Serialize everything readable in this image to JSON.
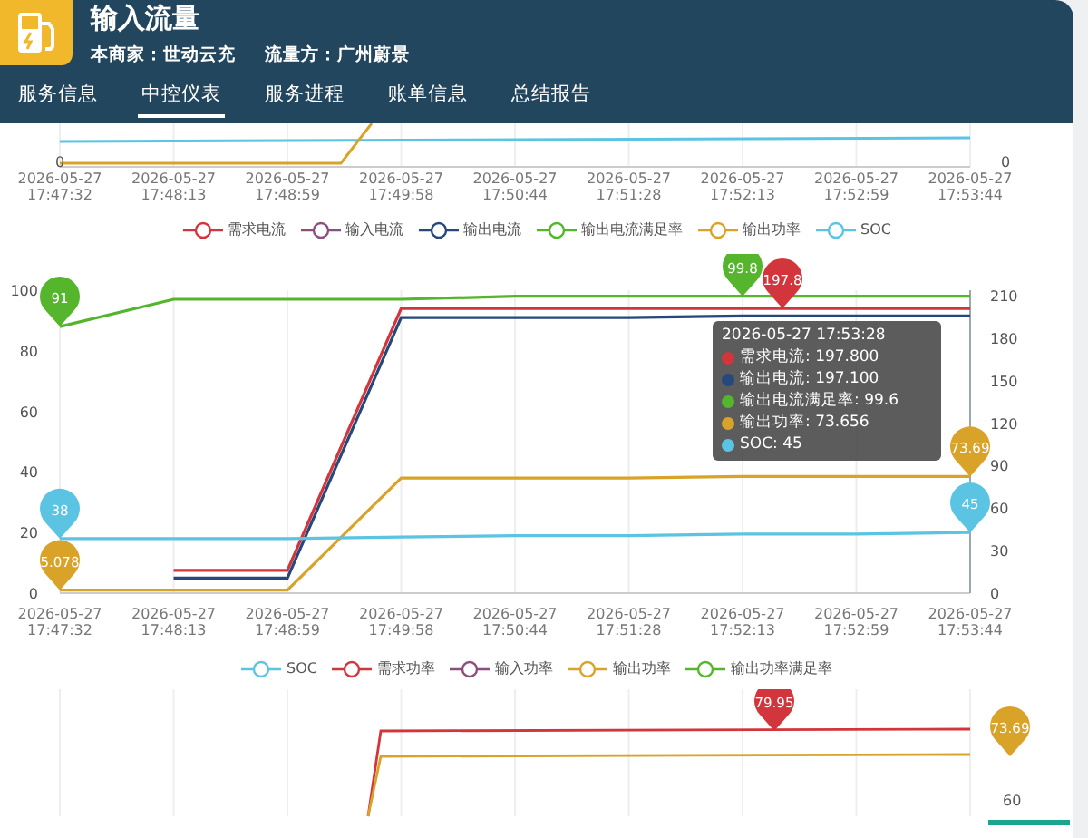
{
  "header": {
    "title": "输入流量",
    "merchant": "本商家：世动云充",
    "flow_party": "流量方：广州蔚景"
  },
  "tabs": [
    {
      "label": "服务信息",
      "selected": false
    },
    {
      "label": "中控仪表",
      "selected": true
    },
    {
      "label": "服务进程",
      "selected": false
    },
    {
      "label": "账单信息",
      "selected": false
    },
    {
      "label": "总结报告",
      "selected": false
    }
  ],
  "top_chart": {
    "left_tick": "0",
    "right_tick": "0",
    "x_labels": [
      "2026-05-27 17:47:32",
      "2026-05-27 17:48:13",
      "2026-05-27 17:48:59",
      "2026-05-27 17:49:58",
      "2026-05-27 17:50:44",
      "2026-05-27 17:51:28",
      "2026-05-27 17:52:13",
      "2026-05-27 17:52:59",
      "2026-05-27 17:53:44"
    ]
  },
  "main_chart": {
    "chart_data": {
      "type": "line",
      "grid": true,
      "categories": [
        "2026-05-27 17:47:32",
        "2026-05-27 17:48:13",
        "2026-05-27 17:48:59",
        "2026-05-27 17:49:58",
        "2026-05-27 17:50:44",
        "2026-05-27 17:51:28",
        "2026-05-27 17:52:13",
        "2026-05-27 17:52:59",
        "2026-05-27 17:53:44"
      ],
      "ylim": [
        0,
        100
      ],
      "yticks": [
        0,
        20,
        40,
        60,
        80,
        100
      ],
      "series": [
        {
          "name": "需求电流",
          "color": "#d2353c",
          "values": [
            null,
            7.5,
            7.5,
            94,
            94,
            94,
            94,
            94,
            94
          ]
        },
        {
          "name": "输入电流",
          "color": "#8a4f7d",
          "values": [
            null,
            null,
            null,
            null,
            null,
            null,
            null,
            null,
            null
          ]
        },
        {
          "name": "输出电流",
          "color": "#27487a",
          "values": [
            null,
            5,
            5,
            91,
            91,
            91,
            91.5,
            91.5,
            91.5
          ]
        },
        {
          "name": "输出电流满足率",
          "color": "#55b52c",
          "values": [
            88,
            97,
            97,
            97,
            98,
            98,
            98,
            98,
            98
          ]
        },
        {
          "name": "输出功率",
          "color": "#d9a32a",
          "values": [
            1,
            1,
            1,
            38,
            38,
            38,
            38.5,
            38.5,
            38.5
          ]
        },
        {
          "name": "SOC",
          "color": "#5ac4e2",
          "values": [
            18,
            18,
            18,
            18.5,
            19,
            19,
            19.5,
            19.5,
            20
          ]
        }
      ],
      "annotations": [
        {
          "x": "2026-05-27 17:47:32",
          "y": 88,
          "text": "91"
        },
        {
          "x": "2026-05-27 17:47:32",
          "y": 18,
          "text": "38"
        },
        {
          "x": "2026-05-27 17:47:32",
          "y": 1,
          "text": "5.078"
        },
        {
          "x": "2026-05-27 17:52:13",
          "y": 98,
          "text": "99.8"
        },
        {
          "x": "2026-05-27 17:52:13",
          "y": 94,
          "text": "197.8"
        },
        {
          "x": "2026-05-27 17:53:44",
          "y": 20,
          "text": "45"
        },
        {
          "x": "2026-05-27 17:53:44",
          "y": 38.5,
          "text": "73.69"
        }
      ]
    },
    "right_ticks": [
      "210",
      "180",
      "150",
      "120",
      "90",
      "60",
      "30",
      "0"
    ],
    "tooltip": {
      "title": "2026-05-27 17:53:28",
      "rows": [
        {
          "label": "需求电流: 197.800",
          "color": "#d2353c"
        },
        {
          "label": "输出电流: 197.100",
          "color": "#27487a"
        },
        {
          "label": "输出电流满足率: 99.6",
          "color": "#55b52c"
        },
        {
          "label": "输出功率: 73.656",
          "color": "#d9a32a"
        },
        {
          "label": "SOC: 45",
          "color": "#5ac4e2"
        }
      ]
    }
  },
  "bottom_chart": {
    "legend": [
      {
        "label": "SOC",
        "color": "#5ac4e2"
      },
      {
        "label": "需求功率",
        "color": "#d2353c"
      },
      {
        "label": "输入功率",
        "color": "#8a4f7d"
      },
      {
        "label": "输出功率",
        "color": "#d9a32a"
      },
      {
        "label": "输出功率满足率",
        "color": "#55b52c"
      }
    ],
    "markers": [
      {
        "label": "79.95",
        "color": "#d2353c"
      },
      {
        "label": "73.69",
        "color": "#d9a32a"
      }
    ],
    "tick": "60"
  }
}
